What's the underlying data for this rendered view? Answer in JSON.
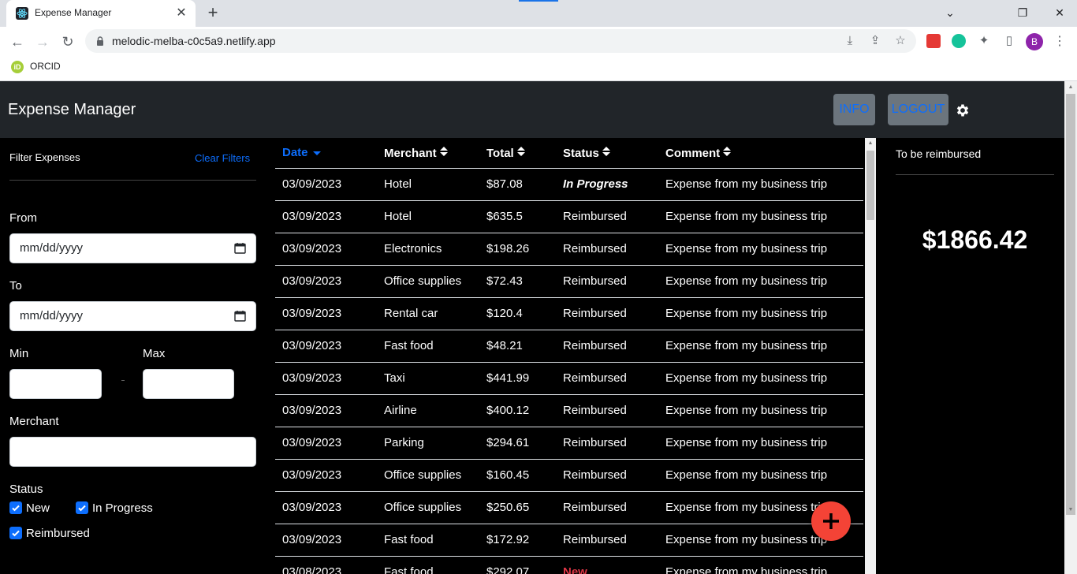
{
  "browser": {
    "tab_title": "Expense Manager",
    "tab_close": "✕",
    "new_tab": "+",
    "url": "melodic-melba-c0c5a9.netlify.app",
    "profile_initial": "B",
    "bookmark_label": "ORCID",
    "bookmark_icon_text": "iD",
    "window_controls": {
      "minimize": "⌄",
      "restore": "❐",
      "close": "✕"
    }
  },
  "app": {
    "brand": "Expense Manager",
    "info_label": "INFO",
    "logout_label": "LOGOUT"
  },
  "filters": {
    "title": "Filter Expenses",
    "clear_label": "Clear Filters",
    "from_label": "From",
    "from_value": "mm/dd/yyyy",
    "to_label": "To",
    "to_value": "mm/dd/yyyy",
    "min_label": "Min",
    "min_value": "",
    "max_label": "Max",
    "max_value": "",
    "merchant_label": "Merchant",
    "merchant_value": "",
    "status_label": "Status",
    "status_options": [
      {
        "label": "New",
        "checked": true
      },
      {
        "label": "In Progress",
        "checked": true
      },
      {
        "label": "Reimbursed",
        "checked": true
      }
    ]
  },
  "table": {
    "headers": [
      "Date",
      "Merchant",
      "Total",
      "Status",
      "Comment"
    ],
    "rows": [
      [
        "03/09/2023",
        "Hotel",
        "$87.08",
        "In Progress",
        "Expense from my business trip"
      ],
      [
        "03/09/2023",
        "Hotel",
        "$635.5",
        "Reimbursed",
        "Expense from my business trip"
      ],
      [
        "03/09/2023",
        "Electronics",
        "$198.26",
        "Reimbursed",
        "Expense from my business trip"
      ],
      [
        "03/09/2023",
        "Office supplies",
        "$72.43",
        "Reimbursed",
        "Expense from my business trip"
      ],
      [
        "03/09/2023",
        "Rental car",
        "$120.4",
        "Reimbursed",
        "Expense from my business trip"
      ],
      [
        "03/09/2023",
        "Fast food",
        "$48.21",
        "Reimbursed",
        "Expense from my business trip"
      ],
      [
        "03/09/2023",
        "Taxi",
        "$441.99",
        "Reimbursed",
        "Expense from my business trip"
      ],
      [
        "03/09/2023",
        "Airline",
        "$400.12",
        "Reimbursed",
        "Expense from my business trip"
      ],
      [
        "03/09/2023",
        "Parking",
        "$294.61",
        "Reimbursed",
        "Expense from my business trip"
      ],
      [
        "03/09/2023",
        "Office supplies",
        "$160.45",
        "Reimbursed",
        "Expense from my business trip"
      ],
      [
        "03/09/2023",
        "Office supplies",
        "$250.65",
        "Reimbursed",
        "Expense from my business trip"
      ],
      [
        "03/09/2023",
        "Fast food",
        "$172.92",
        "Reimbursed",
        "Expense from my business trip"
      ],
      [
        "03/08/2023",
        "Fast food",
        "$292.07",
        "New",
        "Expense from my business trip"
      ]
    ]
  },
  "summary": {
    "title": "To be reimbursed",
    "amount": "$1866.42"
  },
  "colors": {
    "accent": "#0d6efd",
    "fab": "#f44336",
    "new_status": "#dc3545",
    "navbar": "#212529"
  }
}
